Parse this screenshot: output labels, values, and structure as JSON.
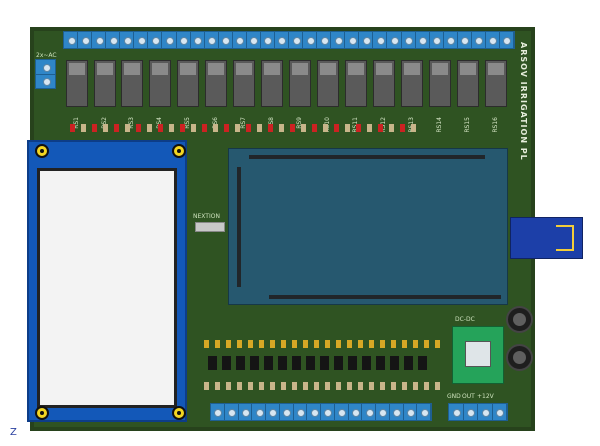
{
  "board": {
    "brand_text": "ARSOV IRRIGATION PL",
    "power_label": "2x~AC",
    "nextion_label": "NEXTION",
    "dc_label": "DC-DC",
    "voltage_label": "+12V",
    "out_label": "OUT",
    "gnd_label": "GND",
    "axis_label": "Z",
    "relay_labels": [
      "RS1",
      "RS2",
      "RS3",
      "RS4",
      "RS5",
      "RS6",
      "RS7",
      "RS8",
      "RS9",
      "RS10",
      "RS11",
      "RS12",
      "RS13",
      "RS14",
      "RS15",
      "RS16"
    ]
  }
}
